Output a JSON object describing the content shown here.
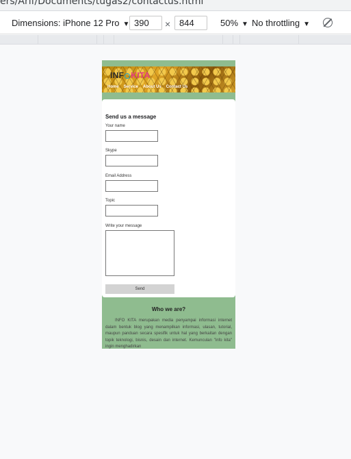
{
  "browser": {
    "url_text": "ers/Arif/Documents/tugas2/contactus.html"
  },
  "devtools": {
    "dimensions_label": "Dimensions: iPhone 12 Pro",
    "width": "390",
    "height": "844",
    "times_sign": "×",
    "zoom": "50%",
    "throttling": "No throttling"
  },
  "site": {
    "logo_part1": "INF",
    "logo_part2": "KITA",
    "nav": {
      "home": "Home",
      "service": "Service",
      "about": "About Us",
      "contact": "Contact Us"
    },
    "form": {
      "title": "Send us a message",
      "name_label": "Your name",
      "skype_label": "Skype",
      "email_label": "Email Address",
      "topic_label": "Topic",
      "message_label": "Write your message",
      "send_label": "Send"
    },
    "about": {
      "title": "Who we are?",
      "text": "INFO KITA merupakan media penyampai informasi internet dalam bentuk blog yang menampilkan informasi, ulasan, tutorial, maupun panduan secara spesifik untuk hal yang berkaitan dengan topik teknologi, bisnis, desain dan internet. Kemunculan \"info kita\" ingin menghadirkan"
    }
  },
  "colors": {
    "page_bg": "#8fbc8f",
    "logo_accent": "#e53980"
  }
}
